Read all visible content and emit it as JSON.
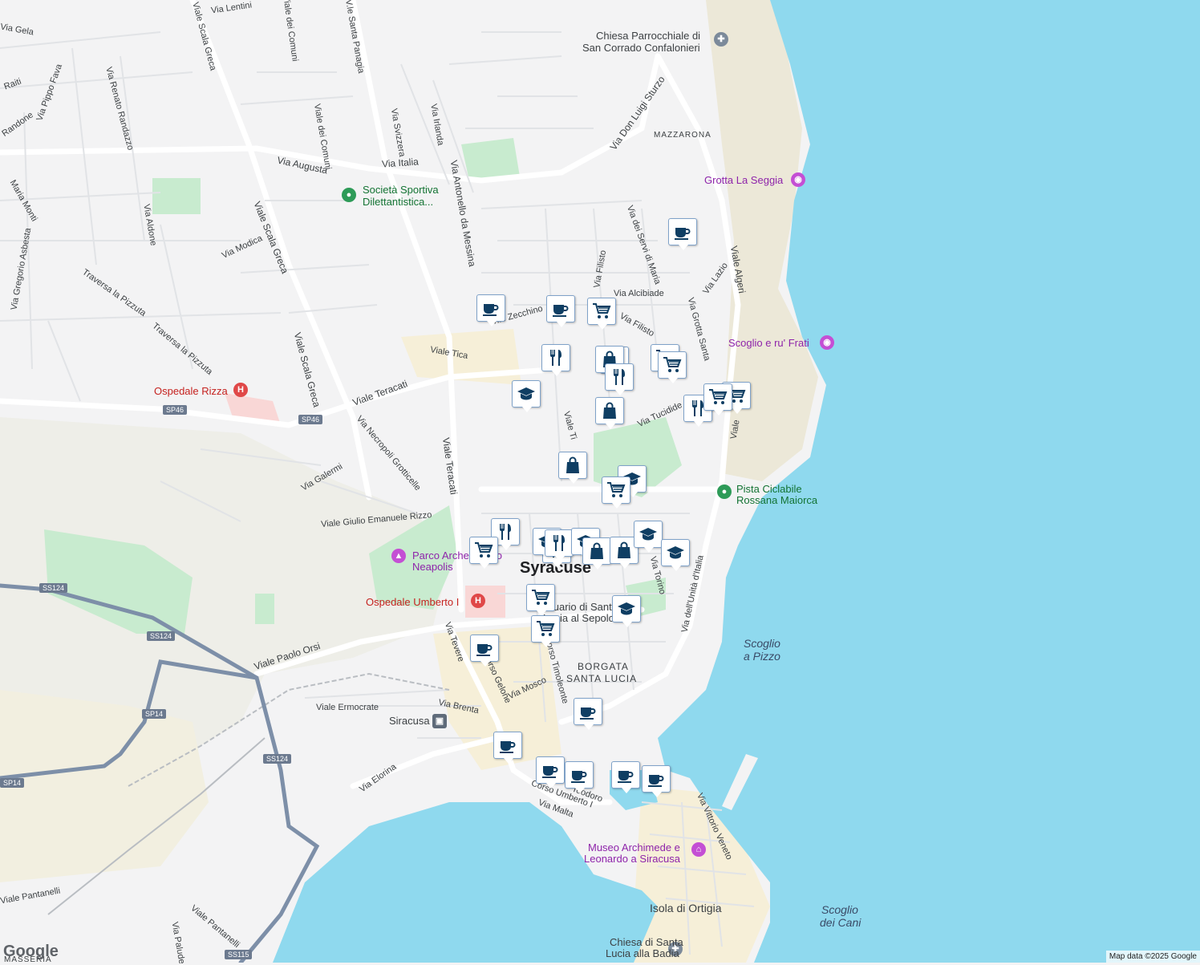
{
  "map": {
    "city": "Syracuse",
    "attribution": "Map data ©2025 Google",
    "logo": "Google",
    "colors": {
      "water": "#8fd9ee",
      "land": "#f3f3f4",
      "road": "#ffffff",
      "park": "#c8ebcf",
      "highway": "#7d8fa8",
      "pin": "#0f3e63"
    }
  },
  "streets": {
    "via_lentini": "Via Lentini",
    "via_gela": "Via Gela",
    "viale_scala_greca_1": "Viale Scala Greca",
    "viale_dei_comuni_1": "Viale dei Comuni",
    "vle_santa_panagia": "V.le Santa Panagia",
    "via_raiti": "Raiti",
    "via_pippo_fava": "Via Pippo Fava",
    "via_randone": "Randone",
    "via_renato_randazzo": "Via Renato Randazzo",
    "viale_dei_comuni_2": "Viale dei Comuni",
    "via_svizzera": "Via Svizzera",
    "via_irlanda": "Via Irlanda",
    "via_augusta": "Via Augusta",
    "via_italia": "Via Italia",
    "via_don_luigi_sturzo": "Via Don Luigi Sturzo",
    "maria_monti": "Maria Monti",
    "via_aldone": "Via Aldone",
    "viale_scala_greca_2": "Viale Scala Greca",
    "via_antonello": "Via Antonello da Messina",
    "via_modica": "Via Modica",
    "via_gregorio": "Via Gregorio Asbesta",
    "traversa_pizzuta_1": "Traversa la Pizzuta",
    "traversa_pizzuta_2": "Traversa la Pizzuta",
    "viale_scala_greca_3": "Viale Scala Greca",
    "via_servi_maria": "Via dei Servi di Maria",
    "via_filisto_1": "Via Filisto",
    "via_lazio": "Via Lazio",
    "viale_algeri": "Viale Algeri",
    "via_alcibiade": "Via Alcibiade",
    "vle_zecchino": "V.le Zecchino",
    "viale_tica": "Viale Tica",
    "via_filisto_2": "Via Filisto",
    "via_grotta_santa": "Via Grotta Santa",
    "viale_teracati_1": "Viale Teracati",
    "via_tucidide": "Via Tucidide",
    "viale_tica_2": "Viale Ti",
    "viale_teracati_2": "Viale Teracati",
    "via_necropoli": "Via Necropoli Grotticelle",
    "via_galermi": "Via Galermi",
    "viale_giulio": "Viale Giulio Emanuele Rizzo",
    "via_torino": "Via Torino",
    "via_unita": "Via dell'Unità d'Italia",
    "viale_paolo_orsi": "Viale Paolo Orsi",
    "via_tevere": "Via Tevere",
    "corso_gelone": "Corso Gelone",
    "corso_timoleonte": "Corso Timoleonte",
    "via_mosco": "Via Mosco",
    "viale_ermocrate": "Viale Ermocrate",
    "via_brenta": "Via Brenta",
    "via_elorina": "Via Elorina",
    "corso_umberto": "Corso Umberto I",
    "via_malta": "Via Malta",
    "via_teodoro": "Teodoro",
    "via_vittorio_veneto": "Via Vittorio Veneto",
    "viale_pantanelli_1": "Viale Pantanelli",
    "viale_pantanelli_2": "Viale Pantanelli",
    "via_palude": "Via Palude",
    "viale_tica_3": "Viale"
  },
  "roads": {
    "sp46_a": "SP46",
    "sp46_b": "SP46",
    "ss124_a": "SS124",
    "ss124_b": "SS124",
    "ss124_c": "SS124",
    "sp14_a": "SP14",
    "sp14_b": "SP14",
    "ss115": "SS115"
  },
  "areas": {
    "mazzarona": "MAZZARONA",
    "borgata": "BORGATA",
    "santa_lucia": "SANTA LUCIA",
    "masseria": "MASSERIA",
    "isola": "Isola di Ortigia"
  },
  "water": {
    "scoglio_pizzo_1": "Scoglio",
    "scoglio_pizzo_2": "a Pizzo",
    "scoglio_cani_1": "Scoglio",
    "scoglio_cani_2": "dei Cani"
  },
  "pois": {
    "chiesa_corrado_1": "Chiesa Parrocchiale di",
    "chiesa_corrado_2": "San Corrado Confalonieri",
    "grotta": "Grotta La Seggia",
    "societa_1": "Società Sportiva",
    "societa_2": "Dilettantistica...",
    "scoglio_frati": "Scoglio e ru' Frati",
    "ospedale_rizza": "Ospedale Rizza",
    "pista_1": "Pista Ciclabile",
    "pista_2": "Rossana Maiorca",
    "parco_1": "Parco Archeologico",
    "parco_2": "Neapolis",
    "ospedale_umberto": "Ospedale Umberto I",
    "santuario_1": "Santuario di Santa",
    "santuario_2": "Lucia al Sepolcro",
    "siracusa_station": "Siracusa",
    "museo_1": "Museo Archimede e",
    "museo_2": "Leonardo a Siracusa",
    "chiesa_lucia_1": "Chiesa di Santa",
    "chiesa_lucia_2": "Lucia alla Badia"
  },
  "markers": [
    {
      "type": "cafe"
    },
    {
      "type": "cafe"
    },
    {
      "type": "cafe"
    },
    {
      "type": "cart"
    },
    {
      "type": "restaurant"
    },
    {
      "type": "cart"
    },
    {
      "type": "shop"
    },
    {
      "type": "restaurant"
    },
    {
      "type": "cart"
    },
    {
      "type": "cart"
    },
    {
      "type": "cart"
    },
    {
      "type": "education"
    },
    {
      "type": "restaurant"
    },
    {
      "type": "cart"
    },
    {
      "type": "shop"
    },
    {
      "type": "shop"
    },
    {
      "type": "education"
    },
    {
      "type": "cart"
    },
    {
      "type": "restaurant"
    },
    {
      "type": "restaurant"
    },
    {
      "type": "cart"
    },
    {
      "type": "education"
    },
    {
      "type": "restaurant"
    },
    {
      "type": "education"
    },
    {
      "type": "shop"
    },
    {
      "type": "shop"
    },
    {
      "type": "education"
    },
    {
      "type": "education"
    },
    {
      "type": "cart"
    },
    {
      "type": "education"
    },
    {
      "type": "cart"
    },
    {
      "type": "cafe"
    },
    {
      "type": "cafe"
    },
    {
      "type": "cafe"
    },
    {
      "type": "cafe"
    },
    {
      "type": "cafe"
    },
    {
      "type": "cafe"
    },
    {
      "type": "cafe"
    }
  ]
}
